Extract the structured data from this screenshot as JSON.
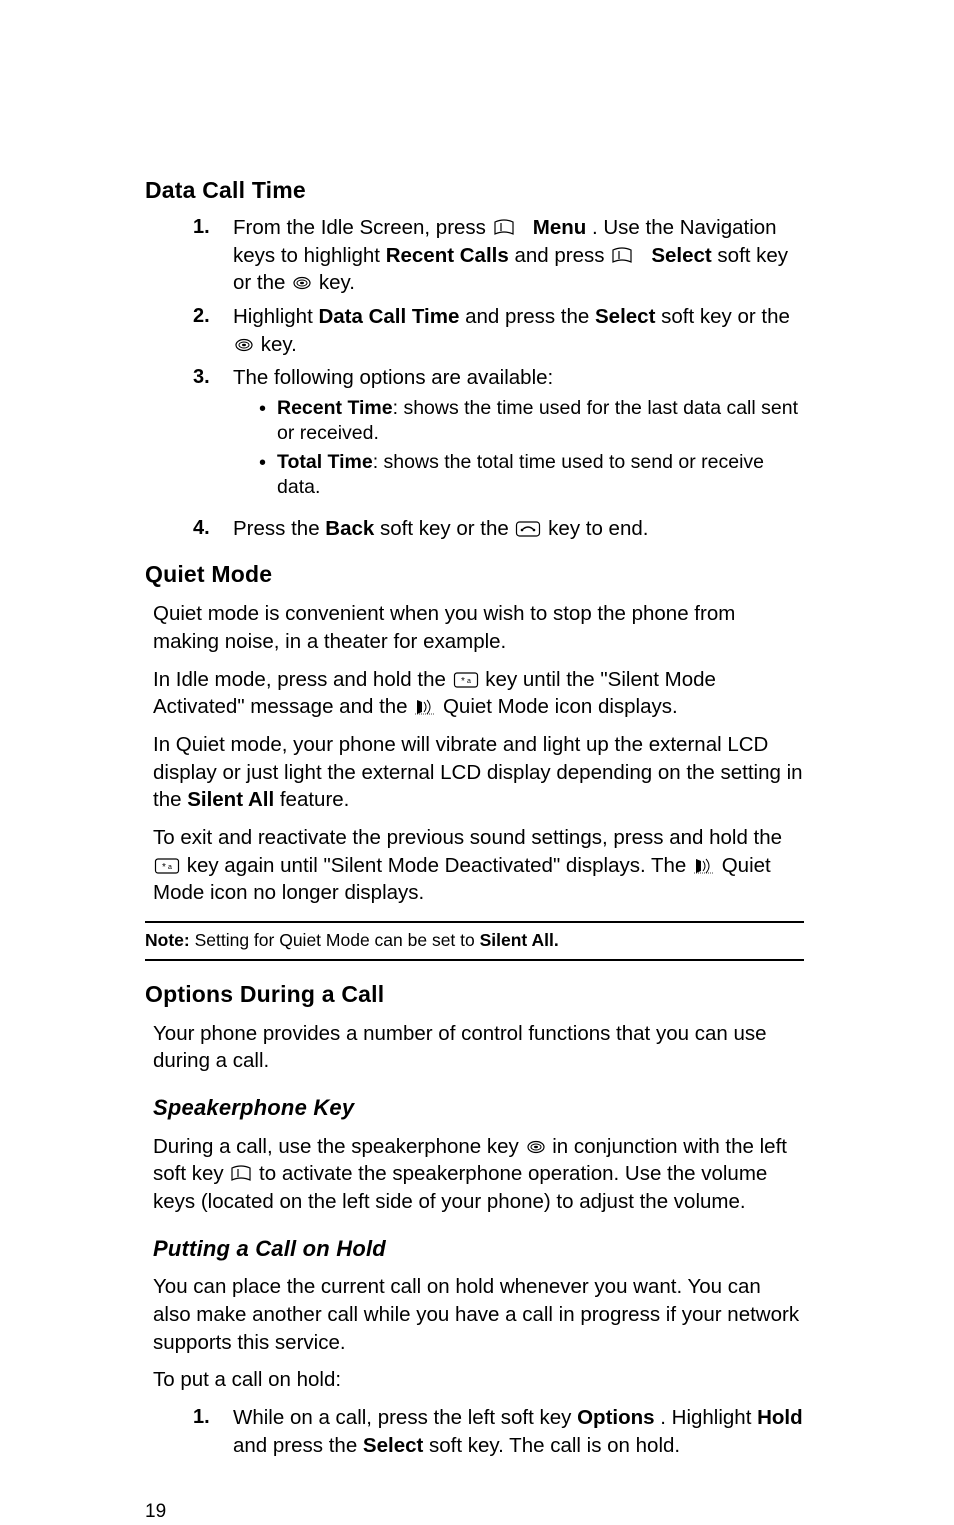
{
  "headings": {
    "h1": "Data Call Time",
    "h2": "Quiet Mode",
    "h3": "Options During a Call",
    "h4": "Speakerphone Key",
    "h5": "Putting a Call on Hold"
  },
  "dct": {
    "l1a": "From the Idle Screen, press ",
    "l1b": "Menu",
    "l1c": ". Use the Navigation keys to highlight ",
    "l1d": "Recent Calls",
    "l1e": " and press ",
    "l1f": "Select",
    "l1g": " soft key or the ",
    "l1h": " key.",
    "l2a": "Highlight ",
    "l2b": "Data Call Time",
    "l2c": " and press the ",
    "l2d": "Select",
    "l2e": " soft key or the ",
    "l2f": " key.",
    "l3": "The following options are available:",
    "b1a": "Recent Time",
    "b1b": ": shows the time used for the last data call sent or received.",
    "b2a": "Total Time",
    "b2b": ": shows the total time used to send or receive data.",
    "l4a": "Press the ",
    "l4b": "Back",
    "l4c": " soft key or the ",
    "l4d": " key to end."
  },
  "quiet": {
    "p1": "Quiet mode is convenient when you wish to stop the phone from making noise, in a theater for example.",
    "p2a": "In Idle mode, press and hold the ",
    "p2b": " key until the \"Silent Mode Activated\" message and the ",
    "p2c": " Quiet Mode icon displays.",
    "p3a": "In Quiet mode, your phone will vibrate and light up the external LCD display or just light the external LCD display depending on the setting in the ",
    "p3b": "Silent All",
    "p3c": " feature.",
    "p4a": "To exit and reactivate the previous sound settings, press and hold the ",
    "p4b": " key again until \"Silent Mode Deactivated\" displays. The ",
    "p4c": " Quiet Mode icon no longer displays."
  },
  "note": {
    "label": "Note: ",
    "text1": "Setting for Quiet Mode can be set to ",
    "text2": "Silent All.",
    "text3": ""
  },
  "options": {
    "p1": "Your phone provides a number of control functions that you can use during a call."
  },
  "speaker": {
    "p1a": "During a call, use the speakerphone key ",
    "p1b": " in conjunction with the left soft key ",
    "p1c": " to activate the speakerphone operation. Use the volume keys (located on the left side of your phone) to adjust the volume."
  },
  "hold": {
    "p1": "You can place the current call on hold whenever you want. You can also make another call while you have a call in progress if your network supports this service.",
    "p2": "To put a call on hold:",
    "l1a": "While on a call, press the left soft key ",
    "l1b": "Options",
    "l1c": ". Highlight ",
    "l1d": "Hold",
    "l1e": " and press the ",
    "l1f": "Select",
    "l1g": " soft key. The call is on hold."
  },
  "pagenum": "19",
  "nums": {
    "n1": "1.",
    "n2": "2.",
    "n3": "3.",
    "n4": "4."
  }
}
